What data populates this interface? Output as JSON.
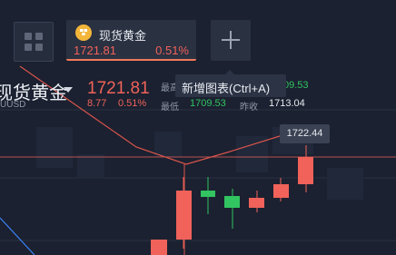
{
  "toolbar": {
    "tab": {
      "name": "现货黄金",
      "price": "1721.81",
      "change_pct": "0.51%",
      "icon": "gold-coin-icon"
    },
    "add_tooltip": "新增图表(Ctrl+A)"
  },
  "header": {
    "title": "现货黄金",
    "subtitle": "UUSD",
    "price": "1721.81",
    "change": "8.77",
    "change_pct": "0.51%",
    "high_label": "最高",
    "high_value": "09.53",
    "low_label": "最低",
    "low_value": "1709.53",
    "prev_close_label": "昨收",
    "prev_close_value": "1713.04"
  },
  "chart": {
    "last_price_tag": "1722.44",
    "colors": {
      "up": "#f0625a",
      "down": "#31c461",
      "ma": "#d9544b",
      "blue": "#3b82f6",
      "price_line": "#f0625a"
    }
  }
}
